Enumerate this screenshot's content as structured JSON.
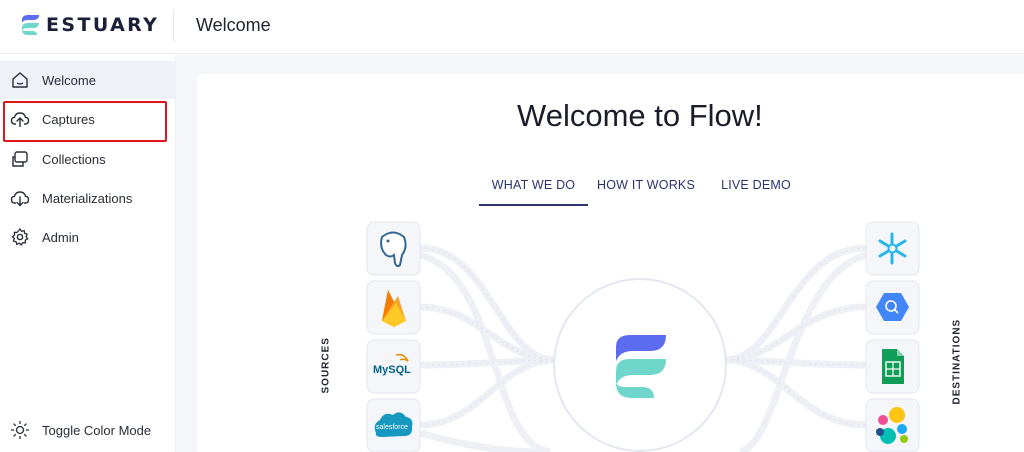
{
  "header": {
    "logo_text": "ESTUARY",
    "page_title": "Welcome"
  },
  "sidebar": {
    "items": [
      {
        "label": "Welcome",
        "icon": "home-icon"
      },
      {
        "label": "Captures",
        "icon": "cloud-upload-icon"
      },
      {
        "label": "Collections",
        "icon": "collections-icon"
      },
      {
        "label": "Materializations",
        "icon": "cloud-download-icon"
      },
      {
        "label": "Admin",
        "icon": "gear-icon"
      }
    ],
    "toggle_color_mode": "Toggle Color Mode"
  },
  "main": {
    "heading": "Welcome to Flow!",
    "tabs": [
      {
        "label": "WHAT WE DO",
        "active": true
      },
      {
        "label": "HOW IT WORKS",
        "active": false
      },
      {
        "label": "LIVE DEMO",
        "active": false
      }
    ],
    "diagram": {
      "sources_label": "SOURCES",
      "destinations_label": "DESTINATIONS",
      "sources": [
        "postgresql-icon",
        "firebase-icon",
        "mysql-icon",
        "salesforce-icon"
      ],
      "destinations": [
        "snowflake-icon",
        "bigquery-icon",
        "google-sheets-icon",
        "elastic-icon"
      ],
      "mysql_text": "MySQL",
      "salesforce_text": "salesforce"
    }
  },
  "colors": {
    "accent": "#2a3470",
    "highlight": "#e0141e",
    "logo_blue": "#5b6cf0",
    "logo_teal": "#6fd6cc"
  }
}
